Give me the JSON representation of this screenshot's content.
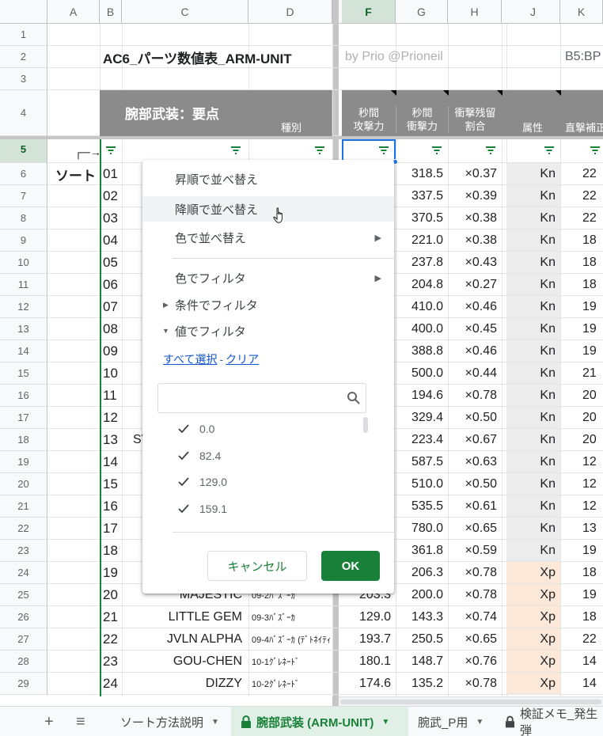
{
  "columns": [
    "A",
    "B",
    "C",
    "D",
    "F",
    "G",
    "H",
    "J",
    "K"
  ],
  "rows": [
    "1",
    "2",
    "3",
    "4",
    "5",
    "6",
    "7",
    "8",
    "9",
    "10",
    "11",
    "12",
    "13",
    "14",
    "15",
    "16",
    "17",
    "18",
    "19",
    "20",
    "21",
    "22",
    "23",
    "24",
    "25",
    "26",
    "27",
    "28",
    "29"
  ],
  "title": "AC6_パーツ数値表_ARM-UNIT",
  "byline": "by Prio @Prioneil",
  "range_label": "B5:BP",
  "header_main": "腕部武装：要点",
  "header_kind": "種別",
  "header_f": [
    "秒間",
    "攻撃力"
  ],
  "header_g": [
    "秒間",
    "衝撃力"
  ],
  "header_h": [
    "衝撃残留",
    "割合"
  ],
  "header_j": "属性",
  "header_k": "直撃補正",
  "sort_arrow": "┌─→",
  "sort_label": "ソート",
  "table": [
    {
      "no": "01",
      "g": "318.5",
      "h": "×0.37",
      "j": "Kn",
      "k": "22"
    },
    {
      "no": "02",
      "g": "337.5",
      "h": "×0.39",
      "j": "Kn",
      "k": "22"
    },
    {
      "no": "03",
      "g": "370.5",
      "h": "×0.38",
      "j": "Kn",
      "k": "22"
    },
    {
      "no": "04",
      "g": "221.0",
      "h": "×0.38",
      "j": "Kn",
      "k": "18"
    },
    {
      "no": "05",
      "g": "237.8",
      "h": "×0.43",
      "j": "Kn",
      "k": "18"
    },
    {
      "no": "06",
      "g": "204.8",
      "h": "×0.27",
      "j": "Kn",
      "k": "18"
    },
    {
      "no": "07",
      "g": "410.0",
      "h": "×0.46",
      "j": "Kn",
      "k": "19"
    },
    {
      "no": "08",
      "g": "400.0",
      "h": "×0.45",
      "j": "Kn",
      "k": "19"
    },
    {
      "no": "09",
      "g": "388.8",
      "h": "×0.46",
      "j": "Kn",
      "k": "19"
    },
    {
      "no": "10",
      "g": "500.0",
      "h": "×0.44",
      "j": "Kn",
      "k": "21"
    },
    {
      "no": "11",
      "g": "194.6",
      "h": "×0.78",
      "j": "Kn",
      "k": "20"
    },
    {
      "no": "12",
      "g": "329.4",
      "h": "×0.50",
      "j": "Kn",
      "k": "20"
    },
    {
      "no": "13",
      "c": "SV",
      "g": "223.4",
      "h": "×0.67",
      "j": "Kn",
      "k": "20"
    },
    {
      "no": "14",
      "g": "587.5",
      "h": "×0.63",
      "j": "Kn",
      "k": "12"
    },
    {
      "no": "15",
      "g": "510.0",
      "h": "×0.50",
      "j": "Kn",
      "k": "12"
    },
    {
      "no": "16",
      "g": "535.5",
      "h": "×0.61",
      "j": "Kn",
      "k": "12"
    },
    {
      "no": "17",
      "g": "780.0",
      "h": "×0.65",
      "j": "Kn",
      "k": "13"
    },
    {
      "no": "18",
      "g": "361.8",
      "h": "×0.59",
      "j": "Kn",
      "k": "19"
    },
    {
      "no": "19",
      "g": "206.3",
      "h": "×0.78",
      "j": "Xp",
      "k": "18"
    },
    {
      "no": "20",
      "c": "MAJESTIC",
      "d": "09-2ﾊﾞｽﾞｰｶ",
      "f": "203.3",
      "g": "200.0",
      "h": "×0.78",
      "j": "Xp",
      "k": "19"
    },
    {
      "no": "21",
      "c": "LITTLE GEM",
      "d": "09-3ﾊﾞｽﾞｰｶ",
      "f": "129.0",
      "g": "143.3",
      "h": "×0.74",
      "j": "Xp",
      "k": "18"
    },
    {
      "no": "22",
      "c": "JVLN ALPHA",
      "d": "09-4ﾊﾞｽﾞｰｶ (ﾃﾞﾄﾈｲﾃｨ",
      "f": "193.7",
      "g": "250.5",
      "h": "×0.65",
      "j": "Xp",
      "k": "22"
    },
    {
      "no": "23",
      "c": "GOU-CHEN",
      "d": "10-1ｸﾞﾚﾈｰﾄﾞ",
      "f": "180.1",
      "g": "148.7",
      "h": "×0.76",
      "j": "Xp",
      "k": "14"
    },
    {
      "no": "24",
      "c": "DIZZY",
      "d": "10-2ｸﾞﾚﾈｰﾄﾞ",
      "f": "174.6",
      "g": "135.2",
      "h": "×0.78",
      "j": "Xp",
      "k": "14"
    }
  ],
  "menu": {
    "sort_asc": "昇順で並べ替え",
    "sort_desc": "降順で並べ替え",
    "sort_color": "色で並べ替え",
    "filter_color": "色でフィルタ",
    "filter_condition": "条件でフィルタ",
    "filter_value": "値でフィルタ",
    "select_all": "すべて選択",
    "separator": "-",
    "clear": "クリア",
    "search_value": "",
    "values": [
      "0.0",
      "82.4",
      "129.0",
      "159.1"
    ],
    "cancel": "キャンセル",
    "ok": "OK"
  },
  "tabs": {
    "add": "+",
    "list": "≡",
    "tab1": "ソート方法説明",
    "tab2": "腕部武装 (ARM-UNIT)",
    "tab3": "腕武_P用",
    "tab4": "検証メモ_発生弾"
  },
  "colors": {
    "accent": "#188038",
    "header_gray": "#8b8b8b",
    "xp_fill": "#fce8d8",
    "kn_fill": "#ececec",
    "select_green": "#d3e3d8"
  }
}
